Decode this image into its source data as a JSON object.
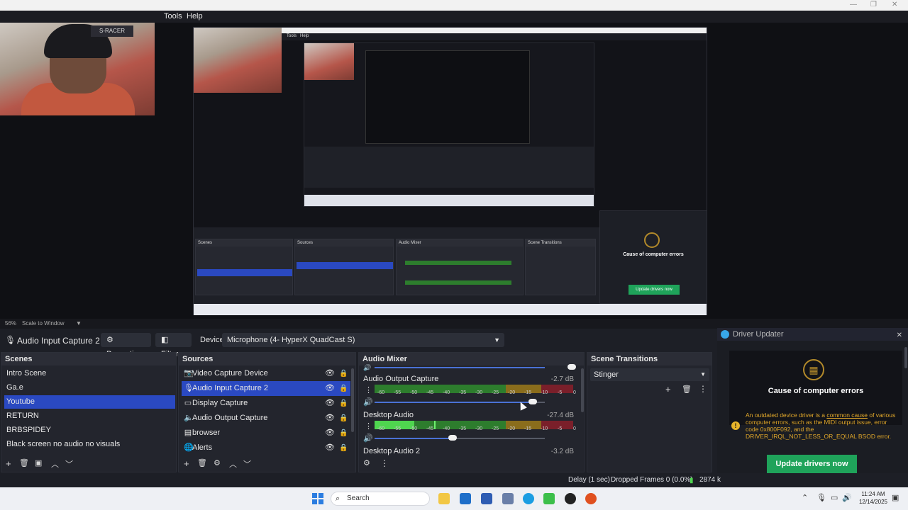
{
  "menubar": {
    "items": [
      "Tools",
      "Help"
    ]
  },
  "preview": {
    "webcam_poster": "S-RACER",
    "nested_menu": [
      "Tools",
      "Help"
    ],
    "nested_driver_title": "Cause of computer errors",
    "nested_update": "Update drivers now"
  },
  "scalebar": {
    "zoom": "56%",
    "mode": "Scale to Window"
  },
  "source_toolbar": {
    "source_name": "Audio Input Capture 2",
    "properties_label": "Properties",
    "filters_label": "Filters",
    "device_label": "Device",
    "device_value": "Microphone (4- HyperX QuadCast S)"
  },
  "scenes": {
    "title": "Scenes",
    "items": [
      {
        "label": "Intro Scene"
      },
      {
        "label": "Ga.e"
      },
      {
        "label": "Youtube",
        "selected": true
      },
      {
        "label": "RETURN"
      },
      {
        "label": "BRBSPIDEY"
      },
      {
        "label": "Black screen no audio no visuals"
      }
    ]
  },
  "sources": {
    "title": "Sources",
    "items": [
      {
        "label": "Video Capture Device",
        "icon": "camera-icon"
      },
      {
        "label": "Audio Input Capture 2",
        "icon": "microphone-icon",
        "selected": true
      },
      {
        "label": "Display Capture",
        "icon": "monitor-icon"
      },
      {
        "label": "Audio Output Capture",
        "icon": "speaker-icon"
      },
      {
        "label": "browser",
        "icon": "browser-icon"
      },
      {
        "label": "Alerts",
        "icon": "globe-icon"
      }
    ]
  },
  "audio_mixer": {
    "title": "Audio Mixer",
    "ticks": [
      "-60",
      "-55",
      "-50",
      "-45",
      "-40",
      "-35",
      "-30",
      "-25",
      "-20",
      "-15",
      "-10",
      "-5",
      "0"
    ],
    "channels": [
      {
        "name": "Audio Output Capture",
        "db": "-2.7 dB",
        "volume": 0.93,
        "level": 0.0
      },
      {
        "name": "Desktop Audio",
        "db": "-27.4 dB",
        "volume": 0.46,
        "level": 0.2
      },
      {
        "name": "Desktop Audio 2",
        "db": "-3.2 dB"
      }
    ]
  },
  "scene_transitions": {
    "title": "Scene Transitions",
    "selected": "Stinger"
  },
  "driver_updater": {
    "title": "Driver Updater",
    "card_title": "Cause of computer errors",
    "message_pre": "An outdated device driver is a ",
    "message_link": "common cause",
    "message_post": " of various computer errors, such as the MIDI output issue, error code 0x800F092, and the DRIVER_IRQL_NOT_LESS_OR_EQUAL BSOD error.",
    "button": "Update drivers now"
  },
  "statusbar": {
    "delay": "Delay (1 sec)",
    "dropped": "Dropped Frames 0 (0.0%)",
    "bitrate": "2874 k"
  },
  "taskbar": {
    "search_placeholder": "Search",
    "time": "11:24 AM",
    "date": "12/14/2025"
  },
  "colors": {
    "accent": "#2a49c1",
    "update_green": "#1fa35a",
    "warning": "#e3a92a"
  }
}
